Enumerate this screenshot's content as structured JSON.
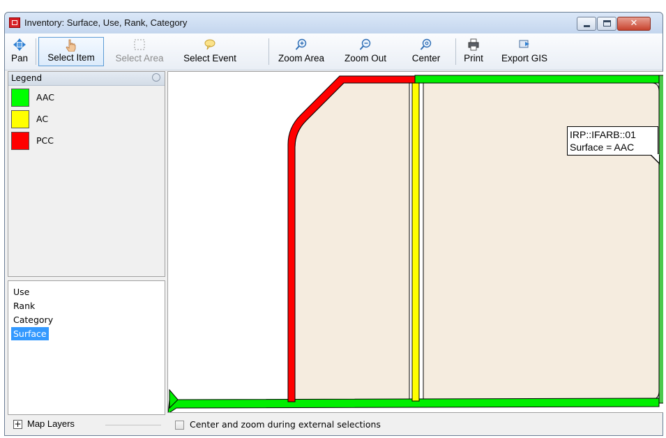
{
  "window": {
    "title": "Inventory: Surface, Use, Rank, Category",
    "close_glyph": "✕"
  },
  "toolbar": {
    "tools": [
      {
        "label": "Pan",
        "icon": "pan-arrows-icon",
        "state": "normal"
      },
      {
        "label": "Select Item",
        "icon": "hand-pointer-icon",
        "state": "active"
      },
      {
        "label": "Select Area",
        "icon": "dashed-rectangle-icon",
        "state": "disabled"
      },
      {
        "label": "Select Event",
        "icon": "speech-bubble-icon",
        "state": "normal"
      },
      {
        "label": "Zoom Area",
        "icon": "zoom-in-icon",
        "state": "normal"
      },
      {
        "label": "Zoom Out",
        "icon": "zoom-out-icon",
        "state": "normal"
      },
      {
        "label": "Center",
        "icon": "zoom-center-icon",
        "state": "normal"
      },
      {
        "label": "Print",
        "icon": "printer-icon",
        "state": "normal"
      },
      {
        "label": "Export GIS",
        "icon": "export-icon",
        "state": "normal"
      }
    ]
  },
  "legend": {
    "title": "Legend",
    "items": [
      {
        "label": "AAC",
        "color": "#00ff00"
      },
      {
        "label": "AC",
        "color": "#ffff00"
      },
      {
        "label": "PCC",
        "color": "#ff0000"
      }
    ]
  },
  "layers": {
    "items": [
      {
        "label": "Use",
        "selected": false
      },
      {
        "label": "Rank",
        "selected": false
      },
      {
        "label": "Category",
        "selected": false
      },
      {
        "label": "Surface",
        "selected": true
      }
    ],
    "expand_glyph": "+",
    "map_layers_label": "Map Layers"
  },
  "map": {
    "parcel_fill": "#f5ecdf",
    "tooltip": {
      "line1": "IRP::IFARB::01",
      "line2": "Surface = AAC"
    }
  },
  "footer": {
    "checkbox_label": "Center and zoom during external selections",
    "checked": false
  }
}
